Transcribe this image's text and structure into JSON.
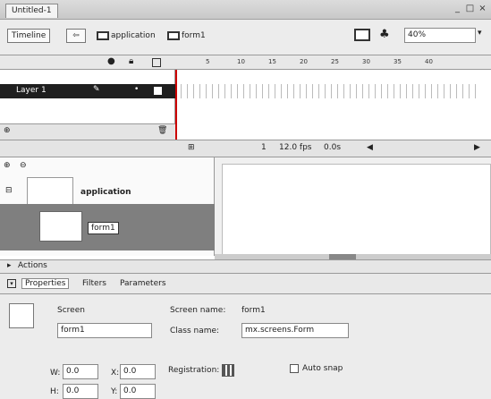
{
  "window": {
    "tab_title": "Untitled-1",
    "minimize": "_",
    "maximize": "□",
    "close": "×"
  },
  "toolbar": {
    "timeline_label": "Timeline",
    "crumb1": "application",
    "crumb2": "form1",
    "zoom": "40%"
  },
  "layers": {
    "items": [
      {
        "name": "Layer 1"
      }
    ]
  },
  "ruler": {
    "ticks": [
      "5",
      "10",
      "15",
      "20",
      "25",
      "30",
      "35",
      "40"
    ]
  },
  "timeline_status": {
    "frame": "1",
    "fps": "12.0 fps",
    "time": "0.0s"
  },
  "screens": {
    "items": [
      {
        "name": "application"
      },
      {
        "name": "form1"
      }
    ]
  },
  "actions": {
    "label": "Actions"
  },
  "props": {
    "tabs": [
      "Properties",
      "Filters",
      "Parameters"
    ],
    "symbol_type": "Screen",
    "instance_name": "form1",
    "screen_name_label": "Screen name:",
    "screen_name": "form1",
    "class_name_label": "Class name:",
    "class_name": "mx.screens.Form",
    "w_label": "W:",
    "w": "0.0",
    "x_label": "X:",
    "x": "0.0",
    "h_label": "H:",
    "h": "0.0",
    "y_label": "Y:",
    "y": "0.0",
    "registration_label": "Registration:",
    "autosnap_label": "Auto snap"
  }
}
